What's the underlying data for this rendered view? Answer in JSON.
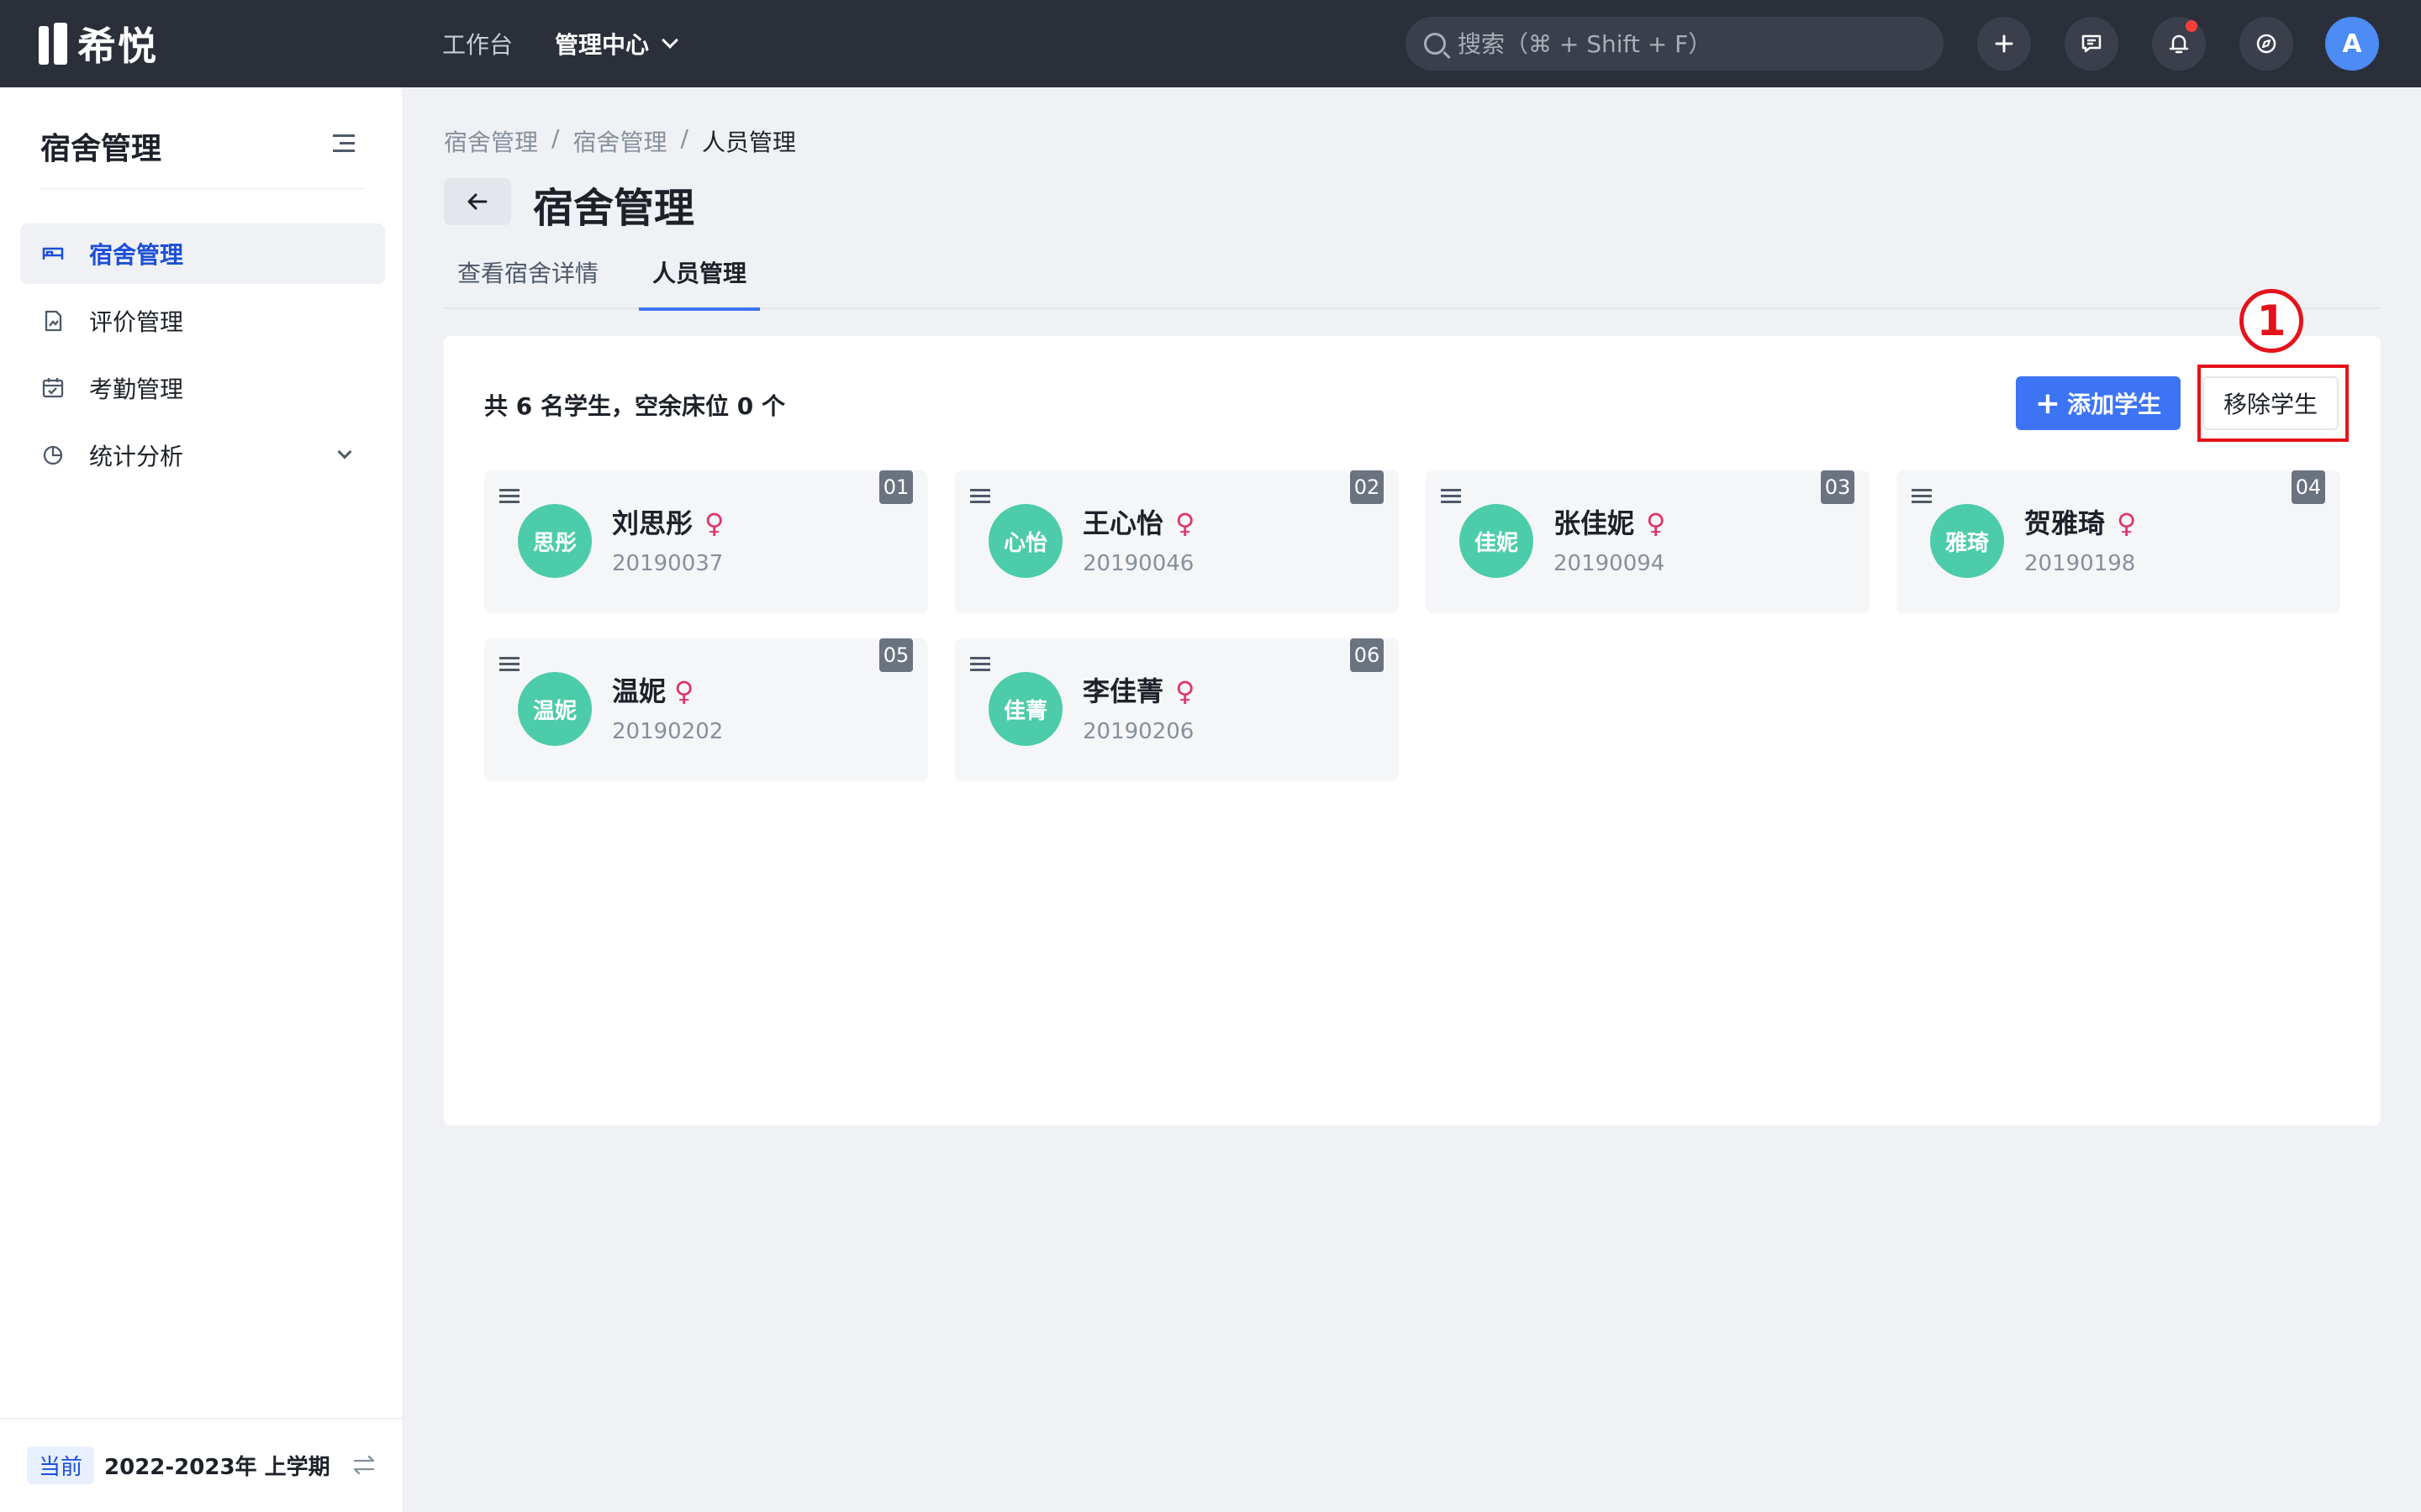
{
  "topbar": {
    "logo_text": "希悦",
    "nav": [
      {
        "label": "工作台"
      },
      {
        "label": "管理中心"
      }
    ],
    "search_placeholder": "搜索（⌘ + Shift + F）",
    "avatar_letter": "A"
  },
  "sidebar": {
    "title": "宿舍管理",
    "items": [
      {
        "label": "宿舍管理",
        "icon": "bed-icon"
      },
      {
        "label": "评价管理",
        "icon": "document-chart-icon"
      },
      {
        "label": "考勤管理",
        "icon": "calendar-check-icon"
      },
      {
        "label": "统计分析",
        "icon": "pie-chart-icon"
      }
    ],
    "footer": {
      "tag": "当前",
      "term": "2022-2023年 上学期"
    }
  },
  "main": {
    "breadcrumb": [
      "宿舍管理",
      "宿舍管理",
      "人员管理"
    ],
    "breadcrumb_sep": "/",
    "title": "宿舍管理",
    "tabs": [
      {
        "label": "查看宿舍详情"
      },
      {
        "label": "人员管理"
      }
    ],
    "summary": "共 6 名学生，空余床位 0 个",
    "add_button": "添加学生",
    "add_plus": "+",
    "remove_button": "移除学生",
    "step_marker": "1",
    "students": [
      {
        "seat": "01",
        "avatar": "思彤",
        "name": "刘思彤",
        "gender": "♀",
        "id": "20190037"
      },
      {
        "seat": "02",
        "avatar": "心怡",
        "name": "王心怡",
        "gender": "♀",
        "id": "20190046"
      },
      {
        "seat": "03",
        "avatar": "佳妮",
        "name": "张佳妮",
        "gender": "♀",
        "id": "20190094"
      },
      {
        "seat": "04",
        "avatar": "雅琦",
        "name": "贺雅琦",
        "gender": "♀",
        "id": "20190198"
      },
      {
        "seat": "05",
        "avatar": "温妮",
        "name": "温妮",
        "gender": "♀",
        "id": "20190202"
      },
      {
        "seat": "06",
        "avatar": "佳菁",
        "name": "李佳菁",
        "gender": "♀",
        "id": "20190206"
      }
    ]
  },
  "colors": {
    "topbar_bg": "#2b2f3a",
    "primary": "#3c74f5",
    "avatar_green": "#4ccca8",
    "female_pink": "#e0336e",
    "highlight_red": "#e4131b"
  }
}
